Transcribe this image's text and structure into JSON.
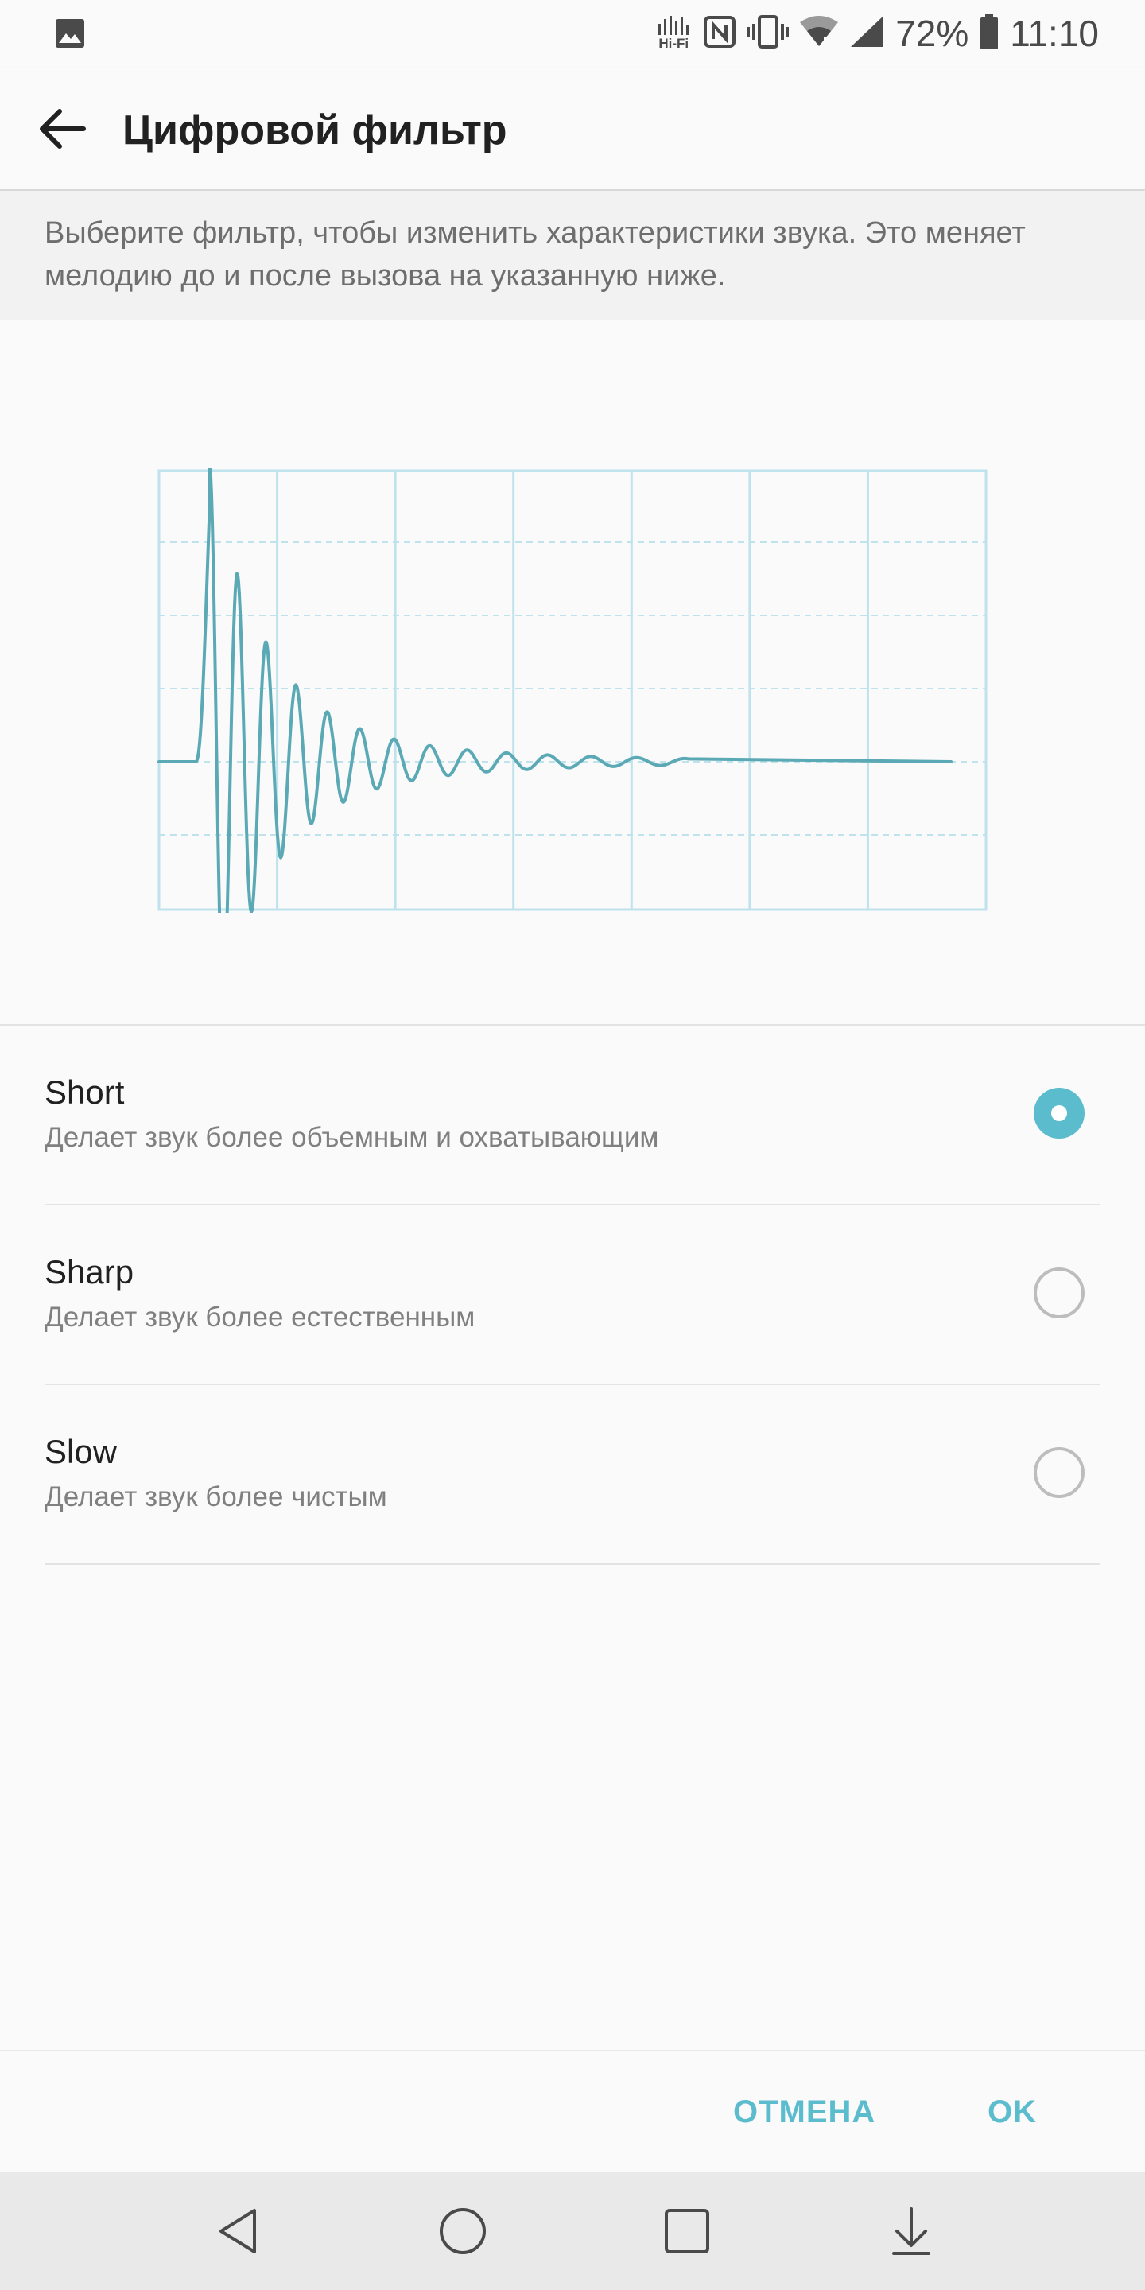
{
  "status_bar": {
    "battery_percent": "72%",
    "time": "11:10",
    "hifi_label_line1": "Hi",
    "hifi_label_line2": "Fi",
    "icons": [
      "gallery-notification-icon",
      "hifi-icon",
      "nfc-icon",
      "vibrate-icon",
      "wifi-icon",
      "signal-icon",
      "battery-icon"
    ]
  },
  "header": {
    "title": "Цифровой фильтр",
    "back_icon": "arrow-back-icon"
  },
  "description": "Выберите фильтр, чтобы изменить характеристики звука. Это меняет мелодию до и после вызова на указанную ниже.",
  "graph": {
    "colors": {
      "grid": "#bfe3ec",
      "wave": "#5aa9b5"
    }
  },
  "options": [
    {
      "title": "Short",
      "description": "Делает звук более объемным и охватывающим",
      "selected": true
    },
    {
      "title": "Sharp",
      "description": "Делает звук более естественным",
      "selected": false
    },
    {
      "title": "Slow",
      "description": "Делает звук более чистым",
      "selected": false
    }
  ],
  "actions": {
    "cancel_label": "ОТМЕНА",
    "ok_label": "OK"
  },
  "nav_bar": {
    "icons": [
      "nav-back-icon",
      "nav-home-icon",
      "nav-recents-icon",
      "nav-notifications-icon"
    ]
  },
  "colors": {
    "accent": "#5bbccd",
    "background": "#fafafa",
    "nav_bar": "#e9e9e9",
    "description_band": "#f2f2f2"
  }
}
